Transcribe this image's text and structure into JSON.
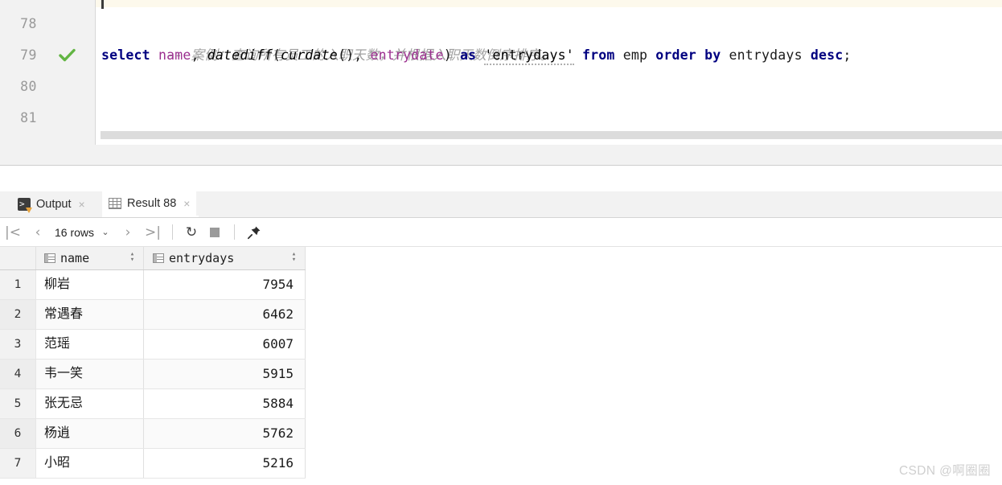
{
  "editor": {
    "line_numbers": [
      "78",
      "79",
      "80",
      "81"
    ],
    "executed_line_marker": "check-icon",
    "lines": [
      {
        "id": "comment",
        "dashes": "-- ",
        "text": "案例：查询所有员工的入职天数，并根据入职天数倒序排序。"
      },
      {
        "id": "sql",
        "tokens": [
          {
            "t": "select",
            "k": "kw"
          },
          {
            "t": " ",
            "k": "plain"
          },
          {
            "t": "name",
            "k": "col"
          },
          {
            "t": ", ",
            "k": "plain"
          },
          {
            "t": "datediff",
            "k": "fn"
          },
          {
            "t": "(",
            "k": "plain"
          },
          {
            "t": "curdate",
            "k": "fn"
          },
          {
            "t": "(), ",
            "k": "plain"
          },
          {
            "t": "entrydate",
            "k": "col"
          },
          {
            "t": ") ",
            "k": "plain"
          },
          {
            "t": "as",
            "k": "kw"
          },
          {
            "t": " ",
            "k": "plain"
          },
          {
            "t": "'entrydays'",
            "k": "alias"
          },
          {
            "t": " ",
            "k": "plain"
          },
          {
            "t": "from",
            "k": "kw"
          },
          {
            "t": " ",
            "k": "plain"
          },
          {
            "t": "emp",
            "k": "plain"
          },
          {
            "t": " ",
            "k": "plain"
          },
          {
            "t": "order",
            "k": "kw"
          },
          {
            "t": " ",
            "k": "plain"
          },
          {
            "t": "by",
            "k": "kw"
          },
          {
            "t": " ",
            "k": "plain"
          },
          {
            "t": "entrydays",
            "k": "plain"
          },
          {
            "t": " ",
            "k": "plain"
          },
          {
            "t": "desc",
            "k": "kw"
          },
          {
            "t": ";",
            "k": "plain"
          }
        ]
      }
    ]
  },
  "tabs": [
    {
      "label": "Output",
      "icon": "console-output-icon",
      "close": "×",
      "active": false
    },
    {
      "label": "Result 88",
      "icon": "result-grid-icon",
      "close": "×",
      "active": true
    }
  ],
  "toolbar": {
    "first_page_icon": "|<",
    "prev_page_icon": "‹",
    "row_count_label": "16 rows",
    "row_count_caret": "⌄",
    "next_page_icon": "›",
    "last_page_icon": ">|",
    "reload_icon": "↻",
    "stop_icon": "stop-square-icon",
    "pin_icon": "📌"
  },
  "grid": {
    "columns": [
      {
        "name": "name",
        "sort_up": "▴",
        "sort_down": "▾"
      },
      {
        "name": "entrydays",
        "sort_up": "▴",
        "sort_down": "▾"
      }
    ],
    "rows": [
      {
        "n": "1",
        "name": "柳岩",
        "entrydays": "7954"
      },
      {
        "n": "2",
        "name": "常遇春",
        "entrydays": "6462"
      },
      {
        "n": "3",
        "name": "范瑶",
        "entrydays": "6007"
      },
      {
        "n": "4",
        "name": "韦一笑",
        "entrydays": "5915"
      },
      {
        "n": "5",
        "name": "张无忌",
        "entrydays": "5884"
      },
      {
        "n": "6",
        "name": "杨逍",
        "entrydays": "5762"
      },
      {
        "n": "7",
        "name": "小昭",
        "entrydays": "5216"
      }
    ]
  },
  "watermark": {
    "text": "CSDN @啊圈圈"
  },
  "colors": {
    "keyword": "#000080",
    "column": "#9b2f8f",
    "comment": "#a0a0a0",
    "check": "#62b543",
    "tab_accent": "#e8a33d"
  }
}
